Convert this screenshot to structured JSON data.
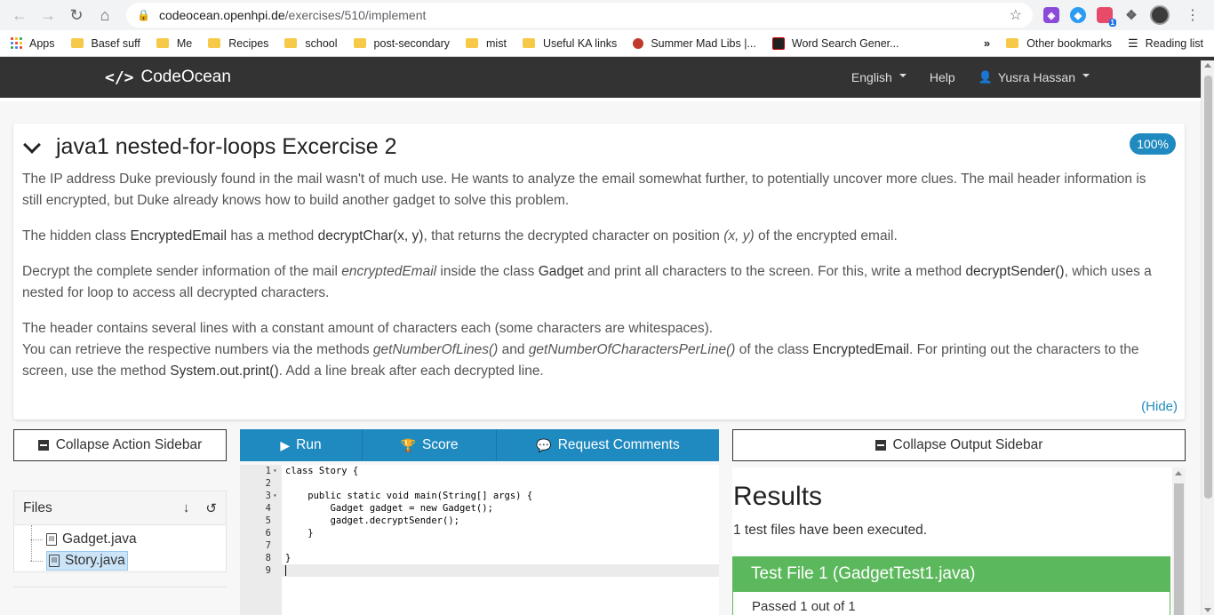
{
  "browser": {
    "url_host": "codeocean.openhpi.de",
    "url_path": "/exercises/510/implement",
    "bookmarks": [
      "Apps",
      "Basef suff",
      "Me",
      "Recipes",
      "school",
      "post-secondary",
      "mist",
      "Useful KA links",
      "Summer Mad Libs |...",
      "Word Search Gener..."
    ],
    "other_bookmarks": "Other bookmarks",
    "reading_list": "Reading list",
    "ext_badge": "1"
  },
  "navbar": {
    "brand": "CodeOcean",
    "brand_icon": "</>",
    "language": "English",
    "help": "Help",
    "user": "Yusra Hassan"
  },
  "exercise": {
    "title": "java1 nested-for-loops Excercise 2",
    "score_badge": "100%",
    "p1": "The IP address Duke previously found in the mail wasn't of much use. He wants to analyze the email somewhat further, to potentially uncover more clues. The mail header information is still encrypted, but Duke already knows how to build another gadget to solve this problem.",
    "p2_a": "The hidden class ",
    "p2_b": "EncryptedEmail",
    "p2_c": " has a method ",
    "p2_d": "decryptChar(x, y)",
    "p2_e": ", that returns the decrypted character on position ",
    "p2_f": "(x, y)",
    "p2_g": " of the encrypted email.",
    "p3_a": "Decrypt the complete sender information of the mail ",
    "p3_b": "encryptedEmail",
    "p3_c": " inside the class ",
    "p3_d": "Gadget",
    "p3_e": " and print all characters to the screen. For this, write a method ",
    "p3_f": "decryptSender()",
    "p3_g": ", which uses a nested for loop to access all decrypted characters.",
    "p4_a": "The header contains several lines with a constant amount of characters each (some characters are whitespaces).",
    "p4_b": "You can retrieve the respective numbers via the methods ",
    "p4_c": "getNumberOfLines()",
    "p4_d": " and ",
    "p4_e": "getNumberOfCharactersPerLine()",
    "p4_f": " of the class ",
    "p4_g": "EncryptedEmail",
    "p4_h": ". For printing out the characters to the screen, use the method ",
    "p4_i": "System.out.print()",
    "p4_j": ". Add a line break after each decrypted line.",
    "hide_link": "(Hide)"
  },
  "sidebar": {
    "collapse_action": "Collapse Action Sidebar",
    "files_header": "Files",
    "files": [
      {
        "name": "Gadget.java",
        "selected": false
      },
      {
        "name": "Story.java",
        "selected": true
      }
    ]
  },
  "toolbar": {
    "run": "Run",
    "score": "Score",
    "request_comments": "Request Comments"
  },
  "editor": {
    "lines": [
      {
        "n": "1",
        "fold": true,
        "text": "class Story {"
      },
      {
        "n": "2",
        "fold": false,
        "text": ""
      },
      {
        "n": "3",
        "fold": true,
        "text": "    public static void main(String[] args) {"
      },
      {
        "n": "4",
        "fold": false,
        "text": "        Gadget gadget = new Gadget();"
      },
      {
        "n": "5",
        "fold": false,
        "text": "        gadget.decryptSender();"
      },
      {
        "n": "6",
        "fold": false,
        "text": "    }"
      },
      {
        "n": "7",
        "fold": false,
        "text": ""
      },
      {
        "n": "8",
        "fold": false,
        "text": "}"
      },
      {
        "n": "9",
        "fold": false,
        "text": ""
      }
    ],
    "active_line": 9
  },
  "output": {
    "collapse_output": "Collapse Output Sidebar",
    "results_title": "Results",
    "results_summary": "1 test files have been executed.",
    "test_file_title": "Test File 1 (GadgetTest1.java)",
    "test_body_partial": "Passed 1 out of 1"
  },
  "colors": {
    "accent": "#1f8ac0",
    "navbar": "#333333",
    "success": "#5cb85c"
  }
}
